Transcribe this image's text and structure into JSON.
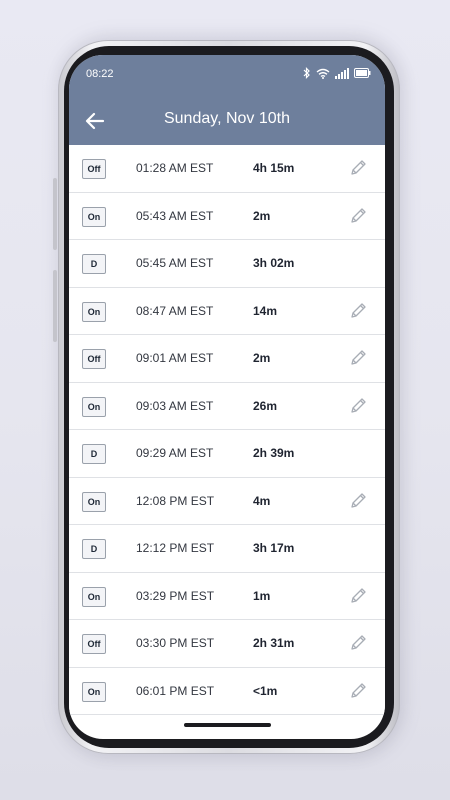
{
  "status_bar": {
    "time": "08:22",
    "icons": [
      "bluetooth-icon",
      "wifi-icon",
      "signal-icon",
      "battery-icon"
    ]
  },
  "header": {
    "title": "Sunday, Nov 10th",
    "back_icon": "back-arrow-icon",
    "background_color": "#6e7f9c"
  },
  "events": [
    {
      "status": "Off",
      "time": "01:28 AM EST",
      "duration": "4h 15m",
      "editable": true
    },
    {
      "status": "On",
      "time": "05:43 AM EST",
      "duration": "2m",
      "editable": true
    },
    {
      "status": "D",
      "time": "05:45 AM EST",
      "duration": "3h 02m",
      "editable": false
    },
    {
      "status": "On",
      "time": "08:47 AM EST",
      "duration": "14m",
      "editable": true
    },
    {
      "status": "Off",
      "time": "09:01 AM EST",
      "duration": "2m",
      "editable": true
    },
    {
      "status": "On",
      "time": "09:03 AM EST",
      "duration": "26m",
      "editable": true
    },
    {
      "status": "D",
      "time": "09:29 AM EST",
      "duration": "2h 39m",
      "editable": false
    },
    {
      "status": "On",
      "time": "12:08 PM EST",
      "duration": "4m",
      "editable": true
    },
    {
      "status": "D",
      "time": "12:12 PM EST",
      "duration": "3h 17m",
      "editable": false
    },
    {
      "status": "On",
      "time": "03:29 PM EST",
      "duration": "1m",
      "editable": true
    },
    {
      "status": "Off",
      "time": "03:30 PM EST",
      "duration": "2h 31m",
      "editable": true
    },
    {
      "status": "On",
      "time": "06:01 PM EST",
      "duration": "<1m",
      "editable": true
    }
  ]
}
